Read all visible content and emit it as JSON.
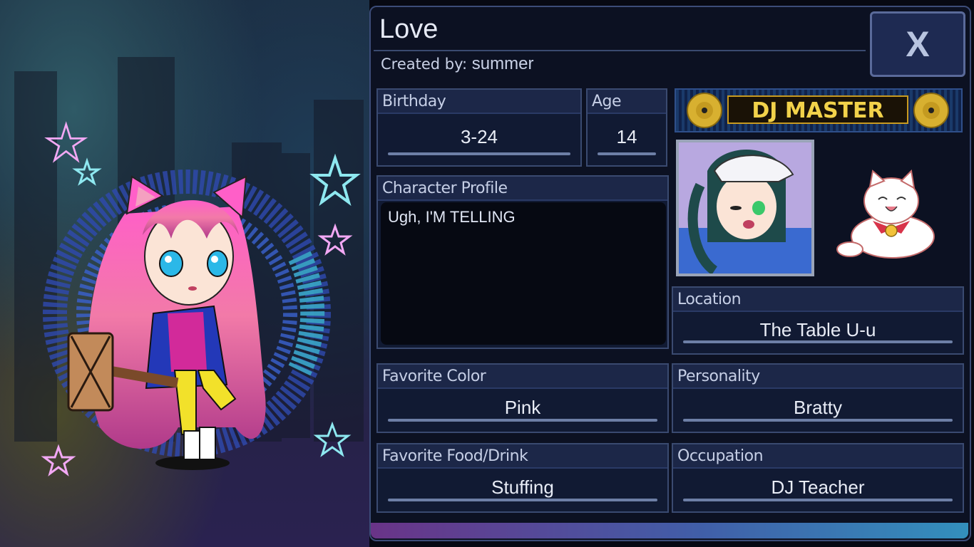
{
  "character": {
    "name": "Love",
    "created_by_label": "Created by:",
    "created_by_value": "summer"
  },
  "close_label": "X",
  "fields": {
    "birthday": {
      "label": "Birthday",
      "value": "3-24"
    },
    "age": {
      "label": "Age",
      "value": "14"
    },
    "profile": {
      "label": "Character Profile",
      "value": "Ugh, I'M TELLING"
    },
    "location": {
      "label": "Location",
      "value": "The Table U-u"
    },
    "favorite_color": {
      "label": "Favorite Color",
      "value": "Pink"
    },
    "personality": {
      "label": "Personality",
      "value": "Bratty"
    },
    "favorite_food": {
      "label": "Favorite Food/Drink",
      "value": "Stuffing"
    },
    "occupation": {
      "label": "Occupation",
      "value": "DJ Teacher"
    }
  },
  "badge": {
    "text": "DJ MASTER"
  },
  "colors": {
    "panel_bg": "#0c1122",
    "label_bg": "#1c2748",
    "border": "#3a4a70",
    "badge_gold": "#e8c23a",
    "hair_pink": "#f06ac0"
  },
  "icons": [
    "close-icon",
    "vinyl-record-icon",
    "cat-mascot-icon",
    "star-icon"
  ]
}
